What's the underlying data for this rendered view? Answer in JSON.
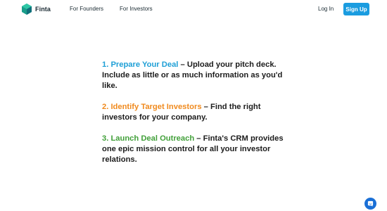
{
  "nav": {
    "brand": "Finta",
    "links": [
      "For Founders",
      "For Investors"
    ],
    "login_label": "Log In",
    "signup_label": "Sign Up"
  },
  "steps": [
    {
      "heading": "1. Prepare Your Deal",
      "separator": " – ",
      "body": "Upload your pitch deck. Include as little or as much information as you'd like."
    },
    {
      "heading": "2. Identify Target Investors",
      "separator": " – ",
      "body": "Find the right investors for your company."
    },
    {
      "heading": "3. Launch Deal Outreach",
      "separator": " – ",
      "body": "Finta's CRM provides one epic mission control for all your investor relations."
    }
  ],
  "colors": {
    "brand_blue": "#1a9ce0",
    "step1": "#1e9fd6",
    "step2": "#f08a1e",
    "step3": "#42a03a",
    "chat": "#1a6fd6"
  },
  "icons": {
    "logo": "finta-logo-icon",
    "chat": "chat-bubble-icon"
  }
}
